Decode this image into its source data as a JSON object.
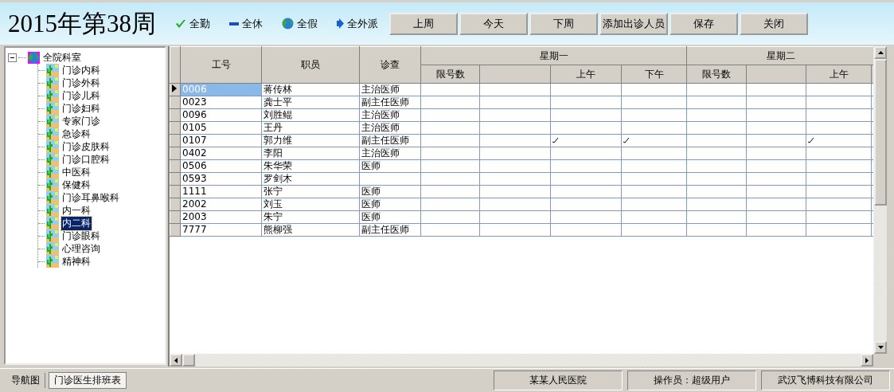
{
  "toolbar": {
    "title": "2015年第38周",
    "quick_actions": [
      {
        "kind": "check",
        "label": "全勤"
      },
      {
        "kind": "dash",
        "label": "全休"
      },
      {
        "kind": "globe",
        "label": "全假"
      },
      {
        "kind": "arrow",
        "label": "全外派"
      }
    ],
    "buttons": [
      "上周",
      "今天",
      "下周",
      "添加出诊人员",
      "保存",
      "关闭"
    ]
  },
  "tree": {
    "label": "全院科室",
    "expanded": true,
    "children": [
      {
        "label": "门诊内科",
        "selected": false
      },
      {
        "label": "门诊外科",
        "selected": false
      },
      {
        "label": "门诊儿科",
        "selected": false
      },
      {
        "label": "门诊妇科",
        "selected": false
      },
      {
        "label": "专家门诊",
        "selected": false
      },
      {
        "label": "急诊科",
        "selected": false
      },
      {
        "label": "门诊皮肤科",
        "selected": false
      },
      {
        "label": "门诊口腔科",
        "selected": false
      },
      {
        "label": "中医科",
        "selected": false
      },
      {
        "label": "保健科",
        "selected": false
      },
      {
        "label": "门诊耳鼻喉科",
        "selected": false
      },
      {
        "label": "内一科",
        "selected": false
      },
      {
        "label": "内二科",
        "selected": true
      },
      {
        "label": "门诊眼科",
        "selected": false
      },
      {
        "label": "心理咨询",
        "selected": false
      },
      {
        "label": "精神科",
        "selected": false
      }
    ]
  },
  "table": {
    "columns": [
      "工号",
      "职员",
      "诊查"
    ],
    "day_groups": [
      {
        "day": "星期一",
        "subcolumns": [
          "限号数",
          "上午",
          "下午"
        ]
      },
      {
        "day": "星期二",
        "subcolumns": [
          "限号数",
          "上午"
        ]
      }
    ],
    "rows": [
      {
        "id": "0006",
        "name": "蒋传林",
        "title": "主治医师",
        "selected": true,
        "mon_am": false,
        "mon_pm": false,
        "tue_am": false
      },
      {
        "id": "0023",
        "name": "龚士平",
        "title": "副主任医师",
        "selected": false,
        "mon_am": false,
        "mon_pm": false,
        "tue_am": false
      },
      {
        "id": "0096",
        "name": "刘胜鲲",
        "title": "主治医师",
        "selected": false,
        "mon_am": false,
        "mon_pm": false,
        "tue_am": false
      },
      {
        "id": "0105",
        "name": "王丹",
        "title": "主治医师",
        "selected": false,
        "mon_am": false,
        "mon_pm": false,
        "tue_am": false
      },
      {
        "id": "0107",
        "name": "郭力维",
        "title": "副主任医师",
        "selected": false,
        "mon_am": true,
        "mon_pm": true,
        "tue_am": true
      },
      {
        "id": "0402",
        "name": "李阳",
        "title": "主治医师",
        "selected": false,
        "mon_am": false,
        "mon_pm": false,
        "tue_am": false
      },
      {
        "id": "0506",
        "name": "朱华荣",
        "title": "医师",
        "selected": false,
        "mon_am": false,
        "mon_pm": false,
        "tue_am": false
      },
      {
        "id": "0593",
        "name": "罗剑木",
        "selected": false,
        "mon_am": false,
        "mon_pm": false,
        "tue_am": false
      },
      {
        "id": "1111",
        "name": "张宁",
        "title": "医师",
        "selected": false,
        "mon_am": false,
        "mon_pm": false,
        "tue_am": false
      },
      {
        "id": "2002",
        "name": "刘玉",
        "title": "医师",
        "selected": false,
        "mon_am": false,
        "mon_pm": false,
        "tue_am": false
      },
      {
        "id": "2003",
        "name": "朱宁",
        "title": "医师",
        "selected": false,
        "mon_am": false,
        "mon_pm": false,
        "tue_am": false
      },
      {
        "id": "7777",
        "name": "熊柳强",
        "title": "副主任医师",
        "selected": false,
        "mon_am": false,
        "mon_pm": false,
        "tue_am": false
      }
    ]
  },
  "bottom_tabs": [
    {
      "label": "导航图",
      "selected": false
    },
    {
      "label": "门诊医生排班表",
      "selected": true
    }
  ],
  "status_bar": [
    "某某人民医院",
    "操作员：超级用户",
    "武汉飞博科技有限公司"
  ]
}
